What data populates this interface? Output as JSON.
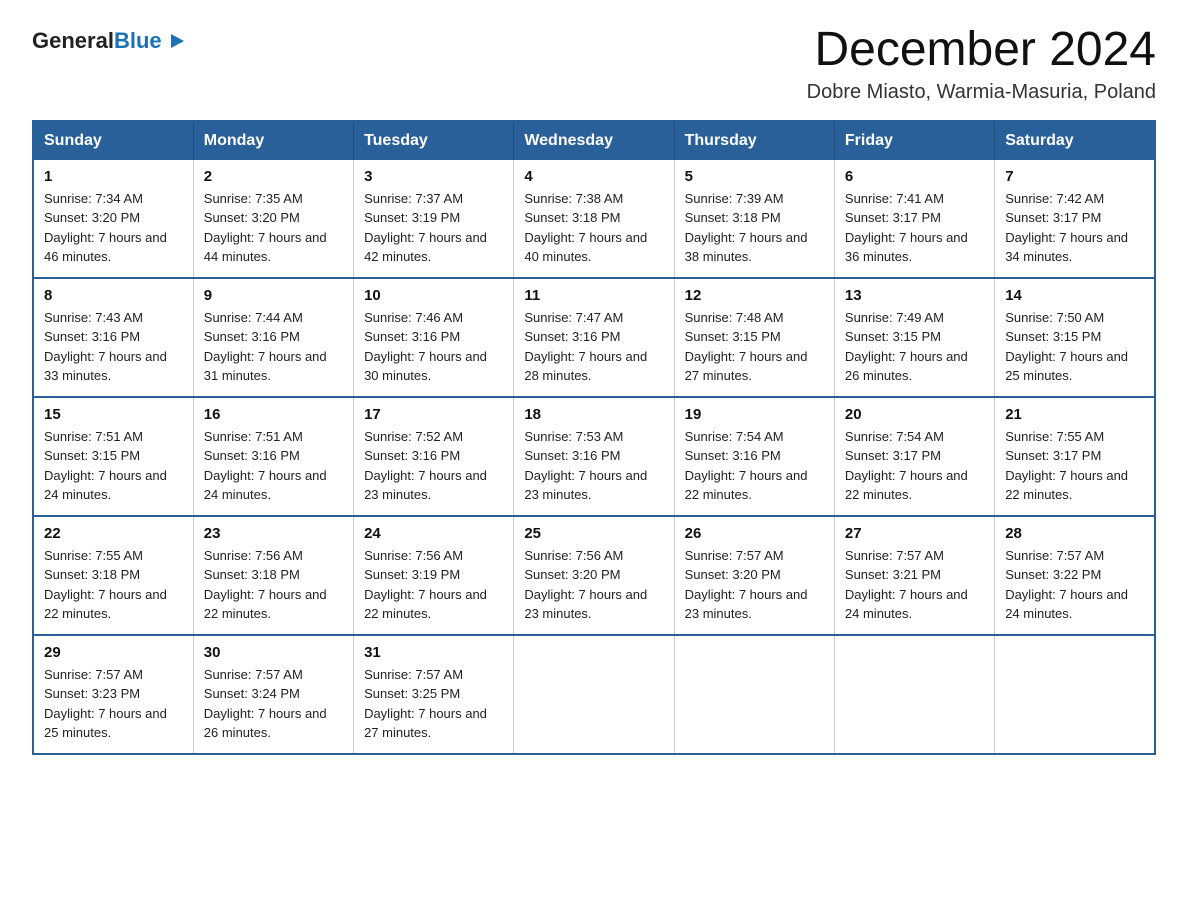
{
  "header": {
    "logo_general": "General",
    "logo_blue": "Blue",
    "month_title": "December 2024",
    "location": "Dobre Miasto, Warmia-Masuria, Poland"
  },
  "days_of_week": [
    "Sunday",
    "Monday",
    "Tuesday",
    "Wednesday",
    "Thursday",
    "Friday",
    "Saturday"
  ],
  "weeks": [
    [
      {
        "day": "1",
        "sunrise": "7:34 AM",
        "sunset": "3:20 PM",
        "daylight": "7 hours and 46 minutes."
      },
      {
        "day": "2",
        "sunrise": "7:35 AM",
        "sunset": "3:20 PM",
        "daylight": "7 hours and 44 minutes."
      },
      {
        "day": "3",
        "sunrise": "7:37 AM",
        "sunset": "3:19 PM",
        "daylight": "7 hours and 42 minutes."
      },
      {
        "day": "4",
        "sunrise": "7:38 AM",
        "sunset": "3:18 PM",
        "daylight": "7 hours and 40 minutes."
      },
      {
        "day": "5",
        "sunrise": "7:39 AM",
        "sunset": "3:18 PM",
        "daylight": "7 hours and 38 minutes."
      },
      {
        "day": "6",
        "sunrise": "7:41 AM",
        "sunset": "3:17 PM",
        "daylight": "7 hours and 36 minutes."
      },
      {
        "day": "7",
        "sunrise": "7:42 AM",
        "sunset": "3:17 PM",
        "daylight": "7 hours and 34 minutes."
      }
    ],
    [
      {
        "day": "8",
        "sunrise": "7:43 AM",
        "sunset": "3:16 PM",
        "daylight": "7 hours and 33 minutes."
      },
      {
        "day": "9",
        "sunrise": "7:44 AM",
        "sunset": "3:16 PM",
        "daylight": "7 hours and 31 minutes."
      },
      {
        "day": "10",
        "sunrise": "7:46 AM",
        "sunset": "3:16 PM",
        "daylight": "7 hours and 30 minutes."
      },
      {
        "day": "11",
        "sunrise": "7:47 AM",
        "sunset": "3:16 PM",
        "daylight": "7 hours and 28 minutes."
      },
      {
        "day": "12",
        "sunrise": "7:48 AM",
        "sunset": "3:15 PM",
        "daylight": "7 hours and 27 minutes."
      },
      {
        "day": "13",
        "sunrise": "7:49 AM",
        "sunset": "3:15 PM",
        "daylight": "7 hours and 26 minutes."
      },
      {
        "day": "14",
        "sunrise": "7:50 AM",
        "sunset": "3:15 PM",
        "daylight": "7 hours and 25 minutes."
      }
    ],
    [
      {
        "day": "15",
        "sunrise": "7:51 AM",
        "sunset": "3:15 PM",
        "daylight": "7 hours and 24 minutes."
      },
      {
        "day": "16",
        "sunrise": "7:51 AM",
        "sunset": "3:16 PM",
        "daylight": "7 hours and 24 minutes."
      },
      {
        "day": "17",
        "sunrise": "7:52 AM",
        "sunset": "3:16 PM",
        "daylight": "7 hours and 23 minutes."
      },
      {
        "day": "18",
        "sunrise": "7:53 AM",
        "sunset": "3:16 PM",
        "daylight": "7 hours and 23 minutes."
      },
      {
        "day": "19",
        "sunrise": "7:54 AM",
        "sunset": "3:16 PM",
        "daylight": "7 hours and 22 minutes."
      },
      {
        "day": "20",
        "sunrise": "7:54 AM",
        "sunset": "3:17 PM",
        "daylight": "7 hours and 22 minutes."
      },
      {
        "day": "21",
        "sunrise": "7:55 AM",
        "sunset": "3:17 PM",
        "daylight": "7 hours and 22 minutes."
      }
    ],
    [
      {
        "day": "22",
        "sunrise": "7:55 AM",
        "sunset": "3:18 PM",
        "daylight": "7 hours and 22 minutes."
      },
      {
        "day": "23",
        "sunrise": "7:56 AM",
        "sunset": "3:18 PM",
        "daylight": "7 hours and 22 minutes."
      },
      {
        "day": "24",
        "sunrise": "7:56 AM",
        "sunset": "3:19 PM",
        "daylight": "7 hours and 22 minutes."
      },
      {
        "day": "25",
        "sunrise": "7:56 AM",
        "sunset": "3:20 PM",
        "daylight": "7 hours and 23 minutes."
      },
      {
        "day": "26",
        "sunrise": "7:57 AM",
        "sunset": "3:20 PM",
        "daylight": "7 hours and 23 minutes."
      },
      {
        "day": "27",
        "sunrise": "7:57 AM",
        "sunset": "3:21 PM",
        "daylight": "7 hours and 24 minutes."
      },
      {
        "day": "28",
        "sunrise": "7:57 AM",
        "sunset": "3:22 PM",
        "daylight": "7 hours and 24 minutes."
      }
    ],
    [
      {
        "day": "29",
        "sunrise": "7:57 AM",
        "sunset": "3:23 PM",
        "daylight": "7 hours and 25 minutes."
      },
      {
        "day": "30",
        "sunrise": "7:57 AM",
        "sunset": "3:24 PM",
        "daylight": "7 hours and 26 minutes."
      },
      {
        "day": "31",
        "sunrise": "7:57 AM",
        "sunset": "3:25 PM",
        "daylight": "7 hours and 27 minutes."
      },
      null,
      null,
      null,
      null
    ]
  ]
}
